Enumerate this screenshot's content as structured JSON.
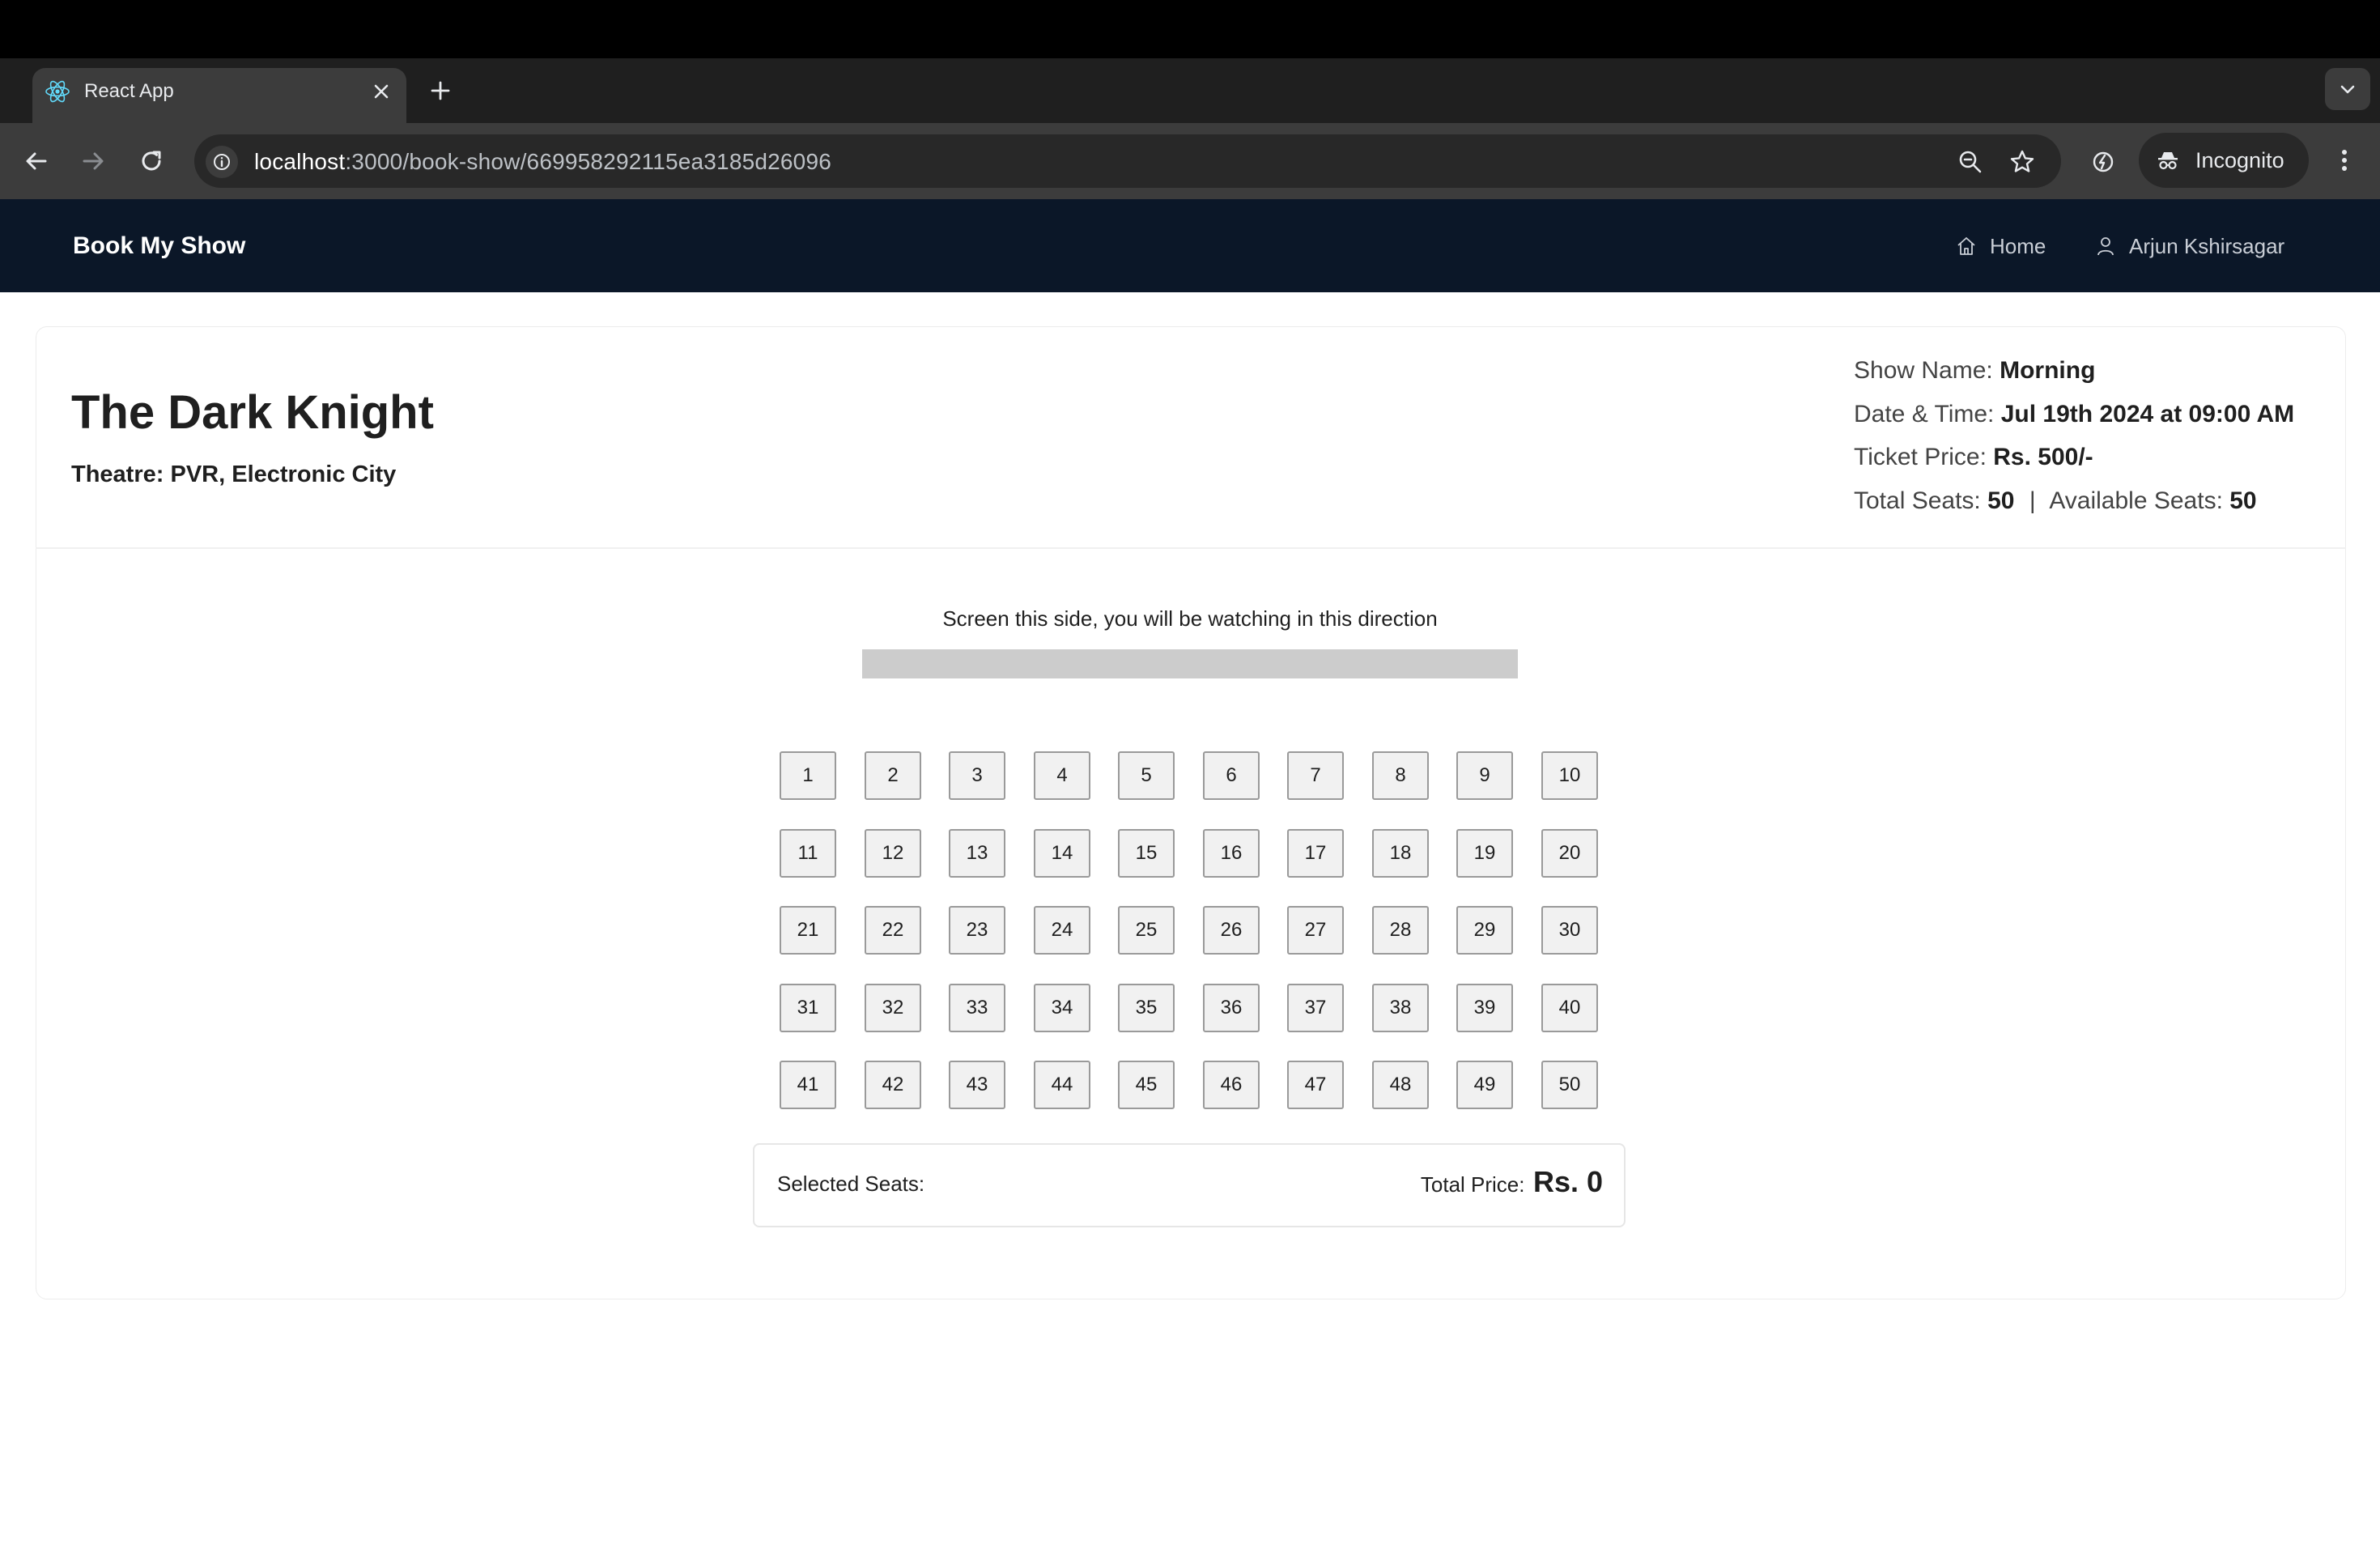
{
  "browser": {
    "tab_title": "React App",
    "url_host": "localhost",
    "url_path": ":3000/book-show/669958292115ea3185d26096",
    "incognito_label": "Incognito"
  },
  "navbar": {
    "brand": "Book My Show",
    "home_label": "Home",
    "user_label": "Arjun Kshirsagar"
  },
  "show": {
    "movie_title": "The Dark Knight",
    "theatre_label": "Theatre:",
    "theatre_value": "PVR, Electronic City",
    "show_name_label": "Show Name:",
    "show_name_value": "Morning",
    "datetime_label": "Date & Time:",
    "datetime_value": "Jul 19th 2024 at 09:00 AM",
    "price_label": "Ticket Price:",
    "price_value": "Rs. 500/-",
    "total_seats_label": "Total Seats:",
    "total_seats_value": "50",
    "separator": "|",
    "available_seats_label": "Available Seats:",
    "available_seats_value": "50"
  },
  "screen": {
    "caption": "Screen this side, you will be watching in this direction"
  },
  "seats": {
    "labels": [
      "1",
      "2",
      "3",
      "4",
      "5",
      "6",
      "7",
      "8",
      "9",
      "10",
      "11",
      "12",
      "13",
      "14",
      "15",
      "16",
      "17",
      "18",
      "19",
      "20",
      "21",
      "22",
      "23",
      "24",
      "25",
      "26",
      "27",
      "28",
      "29",
      "30",
      "31",
      "32",
      "33",
      "34",
      "35",
      "36",
      "37",
      "38",
      "39",
      "40",
      "41",
      "42",
      "43",
      "44",
      "45",
      "46",
      "47",
      "48",
      "49",
      "50"
    ]
  },
  "summary": {
    "selected_label": "Selected Seats:",
    "total_label": "Total Price:",
    "total_value": "Rs. 0"
  }
}
